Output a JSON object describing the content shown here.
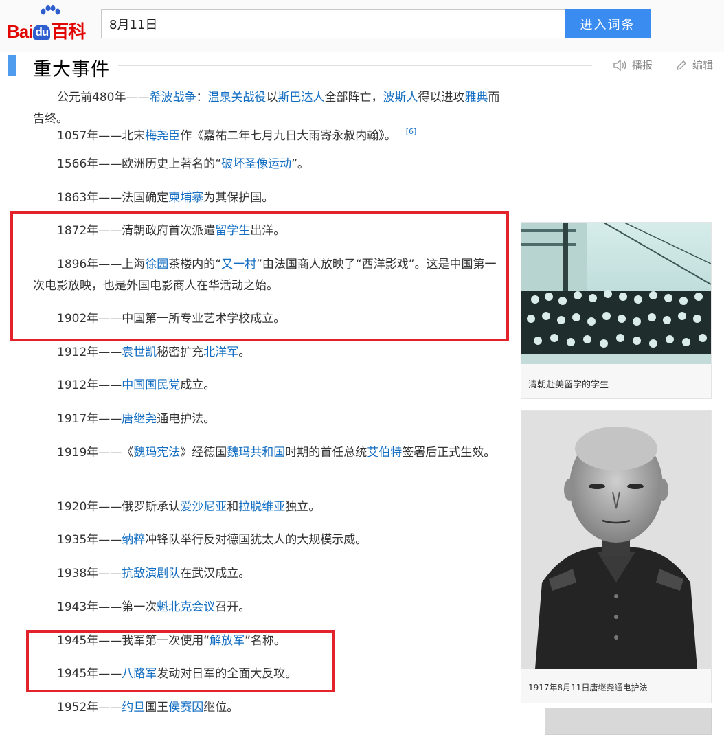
{
  "header": {
    "logo": {
      "text_left": "Bai",
      "text_mid": "du",
      "text_right": "百科"
    },
    "search": {
      "value": "8月11日"
    },
    "enter_button_label": "进入词条"
  },
  "section": {
    "title": "重大事件",
    "listen_label": "播报",
    "edit_label": "编辑"
  },
  "events": [
    {
      "segments": [
        {
          "t": "公元前480年——"
        },
        {
          "t": "希波战争",
          "link": true
        },
        {
          "t": "："
        },
        {
          "t": "温泉关战役",
          "link": true
        },
        {
          "t": "以"
        },
        {
          "t": "斯巴达人",
          "link": true
        },
        {
          "t": "全部阵亡，"
        },
        {
          "t": "波斯人",
          "link": true
        },
        {
          "t": "得以进攻"
        },
        {
          "t": "雅典",
          "link": true
        },
        {
          "t": "而告终。"
        }
      ]
    },
    {
      "segments": [
        {
          "t": "1057年——北宋"
        },
        {
          "t": "梅尧臣",
          "link": true
        },
        {
          "t": "作《嘉祐二年七月九日大雨寄永叔内翰》。"
        }
      ],
      "sup": "[6]"
    },
    {
      "segments": [
        {
          "t": "1566年——欧洲历史上著名的“"
        },
        {
          "t": "破坏圣像运动",
          "link": true
        },
        {
          "t": "”。"
        }
      ]
    },
    {
      "segments": [
        {
          "t": "1863年——法国确定"
        },
        {
          "t": "柬埔寨",
          "link": true
        },
        {
          "t": "为其保护国。"
        }
      ]
    },
    {
      "segments": [
        {
          "t": "1872年——清朝政府首次派遣"
        },
        {
          "t": "留学生",
          "link": true
        },
        {
          "t": "出洋。"
        }
      ]
    },
    {
      "segments": [
        {
          "t": "1896年——上海"
        },
        {
          "t": "徐园",
          "link": true
        },
        {
          "t": "茶楼内的“"
        },
        {
          "t": "又一村",
          "link": true
        },
        {
          "t": "”由法国商人放映了“西洋影戏”。这是中国第一次电影放映，也是外国电影商人在华活动之始。"
        }
      ]
    },
    {
      "segments": [
        {
          "t": "1902年——中国第一所专业艺术学校成立。"
        }
      ]
    },
    {
      "segments": [
        {
          "t": "1912年——"
        },
        {
          "t": "袁世凯",
          "link": true
        },
        {
          "t": "秘密扩充"
        },
        {
          "t": "北洋军",
          "link": true
        },
        {
          "t": "。"
        }
      ]
    },
    {
      "segments": [
        {
          "t": "1912年——"
        },
        {
          "t": "中国国民党",
          "link": true
        },
        {
          "t": "成立。"
        }
      ]
    },
    {
      "segments": [
        {
          "t": "1917年——"
        },
        {
          "t": "唐继尧",
          "link": true
        },
        {
          "t": "通电护法。"
        }
      ]
    },
    {
      "segments": [
        {
          "t": "1919年——《"
        },
        {
          "t": "魏玛宪法",
          "link": true
        },
        {
          "t": "》经德国"
        },
        {
          "t": "魏玛共和国",
          "link": true
        },
        {
          "t": "时期的首任总统"
        },
        {
          "t": "艾伯特",
          "link": true
        },
        {
          "t": "签署后正式生效。"
        }
      ]
    },
    {
      "segments": [
        {
          "t": "1920年——俄罗斯承认"
        },
        {
          "t": "爱沙尼亚",
          "link": true
        },
        {
          "t": "和"
        },
        {
          "t": "拉脱维亚",
          "link": true
        },
        {
          "t": "独立。"
        }
      ]
    },
    {
      "segments": [
        {
          "t": "1935年——"
        },
        {
          "t": "纳粹",
          "link": true
        },
        {
          "t": "冲锋队举行反对德国犹太人的大规模示威。"
        }
      ]
    },
    {
      "segments": [
        {
          "t": "1938年——"
        },
        {
          "t": "抗敌演剧队",
          "link": true
        },
        {
          "t": "在武汉成立。"
        }
      ]
    },
    {
      "segments": [
        {
          "t": "1943年——第一次"
        },
        {
          "t": "魁北克会议",
          "link": true
        },
        {
          "t": "召开。"
        }
      ]
    },
    {
      "segments": [
        {
          "t": "1945年——我军第一次使用“"
        },
        {
          "t": "解放军",
          "link": true
        },
        {
          "t": "”名称。"
        }
      ]
    },
    {
      "segments": [
        {
          "t": "1945年——"
        },
        {
          "t": "八路军",
          "link": true
        },
        {
          "t": "发动对日军的全面大反攻。"
        }
      ]
    },
    {
      "segments": [
        {
          "t": "1952年——"
        },
        {
          "t": "约旦",
          "link": true
        },
        {
          "t": "国王"
        },
        {
          "t": "侯赛因",
          "link": true
        },
        {
          "t": "继位。"
        }
      ]
    }
  ],
  "figures": [
    {
      "caption": "清朝赴美留学的学生"
    },
    {
      "caption": "1917年8月11日唐继尧通电护法"
    }
  ],
  "colors": {
    "link": "#136ec2",
    "accent_bar": "#4f9cee",
    "search_button": "#3b8cf0",
    "annotation_box": "#e2232b"
  }
}
